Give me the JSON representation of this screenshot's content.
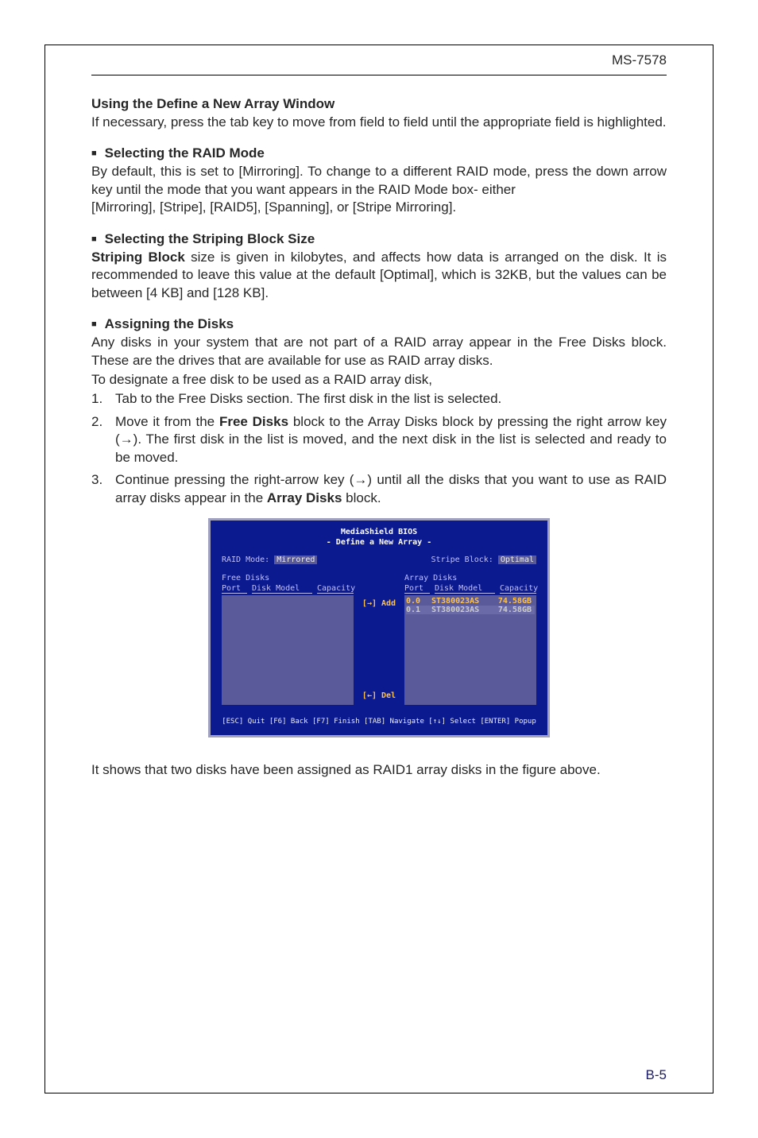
{
  "header": {
    "model": "MS-7578"
  },
  "s1": {
    "title": "Using the Define a New Array Window",
    "body": "If necessary, press the tab key to move from field to field until the appropriate field is highlighted."
  },
  "s2": {
    "title": "Selecting the RAID Mode",
    "body_a": "By default, this is set to [Mirroring]. To change to a different RAID mode, press the down arrow key until the mode that you want appears in the RAID Mode box- either",
    "body_b": "[Mirroring], [Stripe], [RAID5], [Spanning], or [Stripe Mirroring]."
  },
  "s3": {
    "title": "Selecting the Striping Block Size",
    "lead": "Striping Block",
    "body": " size is given in kilobytes, and affects how data is arranged on the disk. It is recommended to leave this value at the default [Optimal], which is 32KB, but the values can be between [4 KB] and [128 KB]."
  },
  "s4": {
    "title": "Assigning the Disks",
    "body_a": "Any disks in your system that are not part of a RAID array appear in the Free Disks block. These are the drives that are available for use as RAID array disks.",
    "body_b": "To designate a free disk to be used as a RAID array disk,",
    "step1": "Tab to the Free Disks section. The first disk in the list is selected.",
    "step2_a": "Move it from the ",
    "step2_b": "Free Disks",
    "step2_c": " block to the Array Disks block by pressing the right arrow key (→). The first disk in the list is moved, and the next disk in the list is selected and ready to be moved.",
    "step3_a": "Continue pressing the right-arrow key (→) until all the disks that you want to use as RAID array disks appear in the ",
    "step3_b": "Array Disks",
    "step3_c": " block."
  },
  "bios": {
    "title1": "MediaShield BIOS",
    "title2": "- Define a New Array -",
    "raid_mode_lbl": "RAID Mode:",
    "raid_mode_val": "Mirrored",
    "stripe_lbl": "Stripe Block:",
    "stripe_val": "Optimal",
    "free_title": "Free Disks",
    "array_title": "Array Disks",
    "col_port": "Port",
    "col_model": "Disk Model",
    "col_cap": "Capacity",
    "add": "[→] Add",
    "del": "[←] Del",
    "rows": [
      {
        "port": "0.0",
        "model": "ST380023AS",
        "cap": "74.58GB"
      },
      {
        "port": "0.1",
        "model": "ST380023AS",
        "cap": "74.58GB"
      }
    ],
    "footer": "[ESC] Quit [F6] Back [F7] Finish [TAB] Navigate [↑↓] Select [ENTER] Popup"
  },
  "closing": "It shows that two disks have been assigned as RAID1 array disks in the figure above.",
  "page_number": "B-5"
}
